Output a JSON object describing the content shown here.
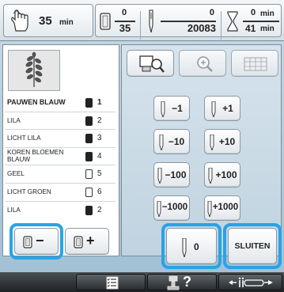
{
  "topbar": {
    "time_value": "35",
    "time_unit": "min",
    "color_fraction_top": "0",
    "color_fraction_bottom": "35",
    "stitch_top": "0",
    "stitch_bottom": "20083",
    "remaining_top_value": "0",
    "remaining_top_unit": "min",
    "remaining_bottom_value": "41",
    "remaining_bottom_unit": "min"
  },
  "threads": [
    {
      "name": "PAUWEN BLAUW",
      "spool": "dark",
      "num": "1",
      "selected": true
    },
    {
      "name": "LILA",
      "spool": "dark",
      "num": "2"
    },
    {
      "name": "LICHT LILA",
      "spool": "dark",
      "num": "3"
    },
    {
      "name": "KOREN BLOEMEN BLAUW",
      "spool": "dark",
      "num": "4"
    },
    {
      "name": "GEEL",
      "spool": "light",
      "num": "5"
    },
    {
      "name": "LICHT GROEN",
      "spool": "light",
      "num": "6"
    },
    {
      "name": "LILA",
      "spool": "dark",
      "num": "2"
    }
  ],
  "left_buttons": {
    "minus": "−",
    "plus": "+"
  },
  "view_buttons": [
    "magnify-view-icon",
    "zoom-icon",
    "grid-icon"
  ],
  "adjust_buttons": [
    {
      "minus": "−1",
      "plus": "+1"
    },
    {
      "minus": "−10",
      "plus": "+10"
    },
    {
      "minus": "−100",
      "plus": "+100"
    },
    {
      "minus": "−1000",
      "plus": "+1000"
    }
  ],
  "zero_button": "0",
  "close_button": "SLUITEN",
  "bottombar": {
    "question": "?"
  },
  "colors": {
    "highlight": "#29a3e6"
  }
}
